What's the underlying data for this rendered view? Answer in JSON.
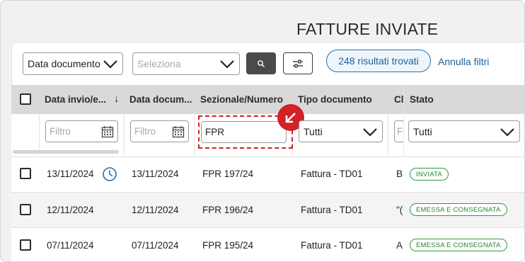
{
  "page": {
    "title": "FATTURE INVIATE"
  },
  "toolbar": {
    "date_type_select": "Data documento",
    "period_select_placeholder": "Seleziona",
    "results_label": "248 risultati trovati",
    "clear_filters_label": "Annulla filtri"
  },
  "table": {
    "columns": {
      "data_invio": "Data invio/e...",
      "sort_arrow": "↓",
      "data_documento": "Data docum...",
      "sezionale": "Sezionale/Numero",
      "tipo": "Tipo documento",
      "cliente_partial": "Cl",
      "stato": "Stato"
    },
    "filters": {
      "data_invio_placeholder": "Filtro",
      "data_documento_placeholder": "Filtro",
      "sezionale_value": "FPR",
      "tipo_value": "Tutti",
      "cliente_partial": "F",
      "stato_value": "Tutti"
    },
    "rows": [
      {
        "data_invio": "13/11/2024",
        "data_documento": "13/11/2024",
        "numero": "FPR 197/24",
        "tipo": "Fattura - TD01",
        "cliente_partial": "B",
        "stato": "INVIATA",
        "has_clock": true
      },
      {
        "data_invio": "12/11/2024",
        "data_documento": "12/11/2024",
        "numero": "FPR 196/24",
        "tipo": "Fattura - TD01",
        "cliente_partial": "\"(",
        "stato": "EMESSA E CONSEGNATA",
        "has_clock": false
      },
      {
        "data_invio": "07/11/2024",
        "data_documento": "07/11/2024",
        "numero": "FPR 195/24",
        "tipo": "Fattura - TD01",
        "cliente_partial": "A",
        "stato": "EMESSA E CONSEGNATA",
        "has_clock": false
      }
    ]
  },
  "colors": {
    "accent_blue": "#1f5e99",
    "status_green": "#2f9a3c",
    "highlight_red": "#d42027",
    "header_gray": "#d9d9d9"
  },
  "icons": [
    "chevron-down-icon",
    "search-icon",
    "filter-settings-icon",
    "calendar-icon",
    "clock-icon",
    "arrow-down-left-icon"
  ]
}
